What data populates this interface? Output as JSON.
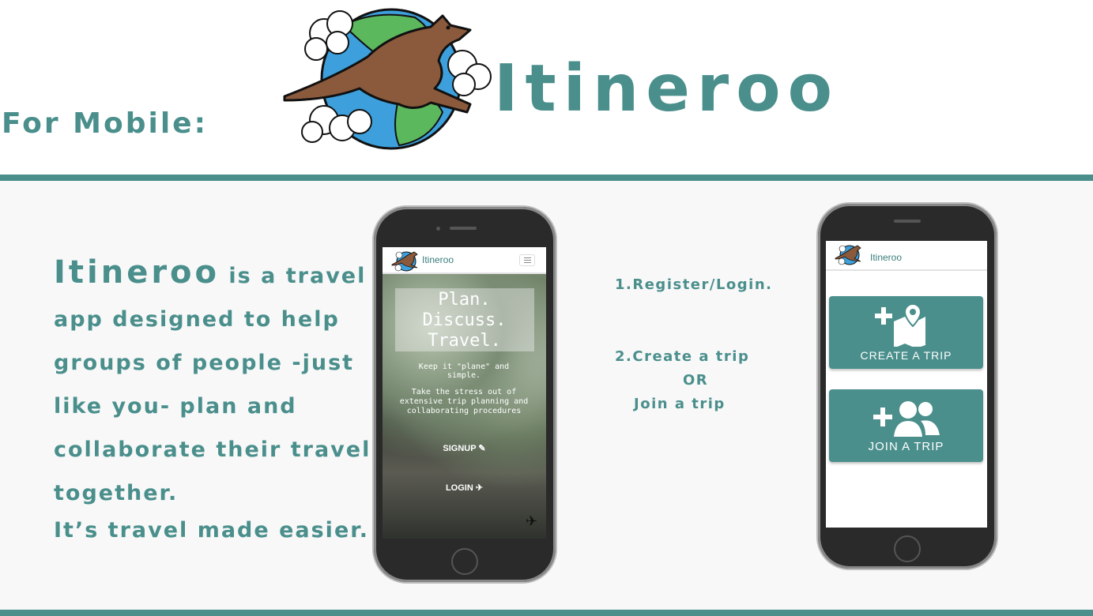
{
  "header": {
    "platform_label": "For Mobile:",
    "brand_title": "Itineroo"
  },
  "description": {
    "brand_word": "Itineroo",
    "body": " is a travel app designed to help groups of people -just like you- plan and collaborate their travel together.",
    "closing": "It’s travel made easier."
  },
  "phone_left": {
    "app_title": "Itineroo",
    "hero": {
      "line1": "Plan.",
      "line2": "Discuss.",
      "line3": "Travel.",
      "keep_text": "Keep it \"plane\" and simple.",
      "stress_text": "Take the stress out of extensive trip planning and collaborating procedures",
      "signup_label": "SIGNUP ✎",
      "login_label": "LOGIN ✈"
    }
  },
  "steps": {
    "step1": "1.Register/Login.",
    "step2": "2.Create a trip",
    "or": "OR",
    "join": "Join a trip"
  },
  "phone_right": {
    "app_title": "Itineroo",
    "create_label": "CREATE A TRIP",
    "join_label": "JOIN A TRIP"
  },
  "colors": {
    "accent": "#4a8f8c",
    "kangaroo": "#8b5a3c",
    "globe_water": "#3da0dc",
    "globe_land": "#5cb85c"
  }
}
